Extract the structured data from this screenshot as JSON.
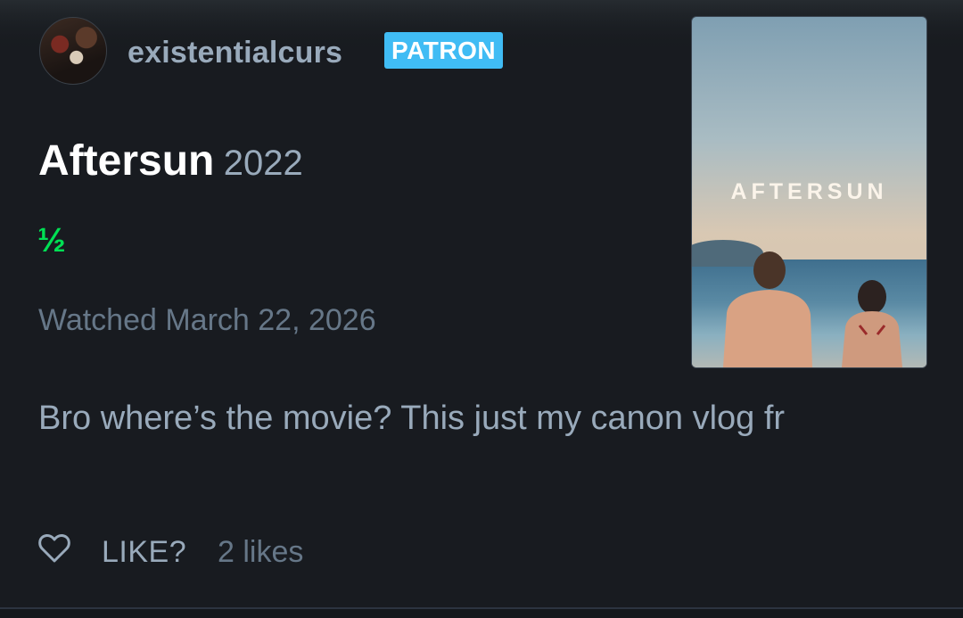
{
  "review": {
    "username": "existentialcurs",
    "badge": "PATRON",
    "film_title": "Aftersun",
    "film_year": "2022",
    "rating": "½",
    "watched": "Watched March 22, 2026",
    "text": "Bro where’s the movie? This just my canon vlog fr",
    "like_label": "LIKE?",
    "like_count": "2 likes"
  },
  "poster": {
    "title": "AFTERSUN"
  },
  "colors": {
    "background": "#14181c",
    "rating_green": "#00e054",
    "badge_blue": "#40bcf4",
    "muted_text": "#99aabb"
  },
  "icons": [
    "avatar",
    "heart-icon"
  ]
}
